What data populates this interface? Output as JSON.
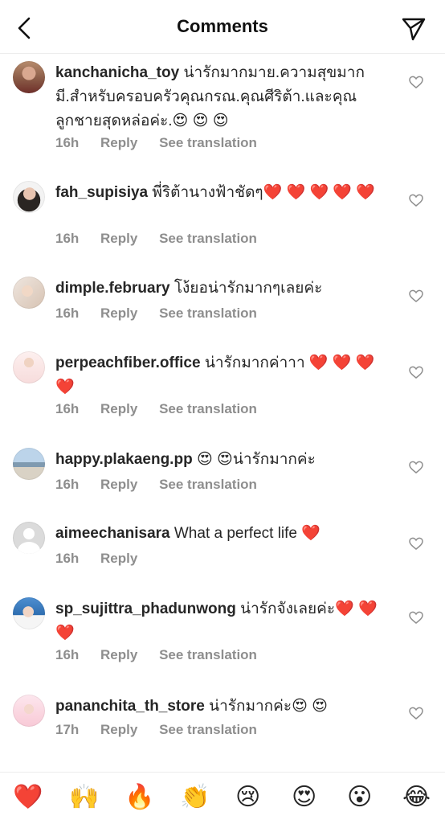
{
  "header": {
    "title": "Comments"
  },
  "comments": [
    {
      "username": "kanchanicha_toy",
      "text": " น่ารักมากมาย.ความสุขมากมี.สำหรับครอบครัวคุณกรณ.คุณศีริต้า.และคุณลูกชายสุดหล่อค่ะ.😍 😍 😍",
      "time": "16h",
      "reply": "Reply",
      "translation": "See translation",
      "avatar": "avatar-photo"
    },
    {
      "username": "fah_supisiya",
      "text": " พี่ริต้านางฟ้าชัดๆ❤️ ❤️ ❤️ ❤️ ❤️",
      "time": "16h",
      "reply": "Reply",
      "translation": "See translation",
      "avatar": "avatar-photo"
    },
    {
      "username": "dimple.february",
      "text": " โง้ยอน่ารักมากๆเลยค่ะ",
      "time": "16h",
      "reply": "Reply",
      "translation": "See translation",
      "avatar": "avatar-photo"
    },
    {
      "username": "perpeachfiber.office",
      "text": " น่ารักมากค่าาา ❤️ ❤️ ❤️ ❤️",
      "time": "16h",
      "reply": "Reply",
      "translation": "See translation",
      "avatar": "avatar-photo"
    },
    {
      "username": "happy.plakaeng.pp",
      "text": " 😍 😍น่ารักมากค่ะ",
      "time": "16h",
      "reply": "Reply",
      "translation": "See translation",
      "avatar": "avatar-photo"
    },
    {
      "username": "aimeechanisara",
      "text": " What a perfect life ❤️",
      "time": "16h",
      "reply": "Reply",
      "translation": "",
      "avatar": "default-avatar"
    },
    {
      "username": "sp_sujittra_phadunwong",
      "text": " น่ารักจังเลยค่ะ❤️ ❤️ ❤️",
      "time": "16h",
      "reply": "Reply",
      "translation": "See translation",
      "avatar": "avatar-photo"
    },
    {
      "username": "pananchita_th_store",
      "text": " น่ารักมากค่ะ😍 😍",
      "time": "17h",
      "reply": "Reply",
      "translation": "See translation",
      "avatar": "avatar-photo"
    }
  ],
  "emoji_bar": [
    "❤️",
    "🙌",
    "🔥",
    "👏",
    "😢",
    "😍",
    "😮",
    "😂"
  ],
  "icons": {
    "back": "chevron-left-icon",
    "send": "paper-plane-icon",
    "like": "heart-outline-icon"
  }
}
